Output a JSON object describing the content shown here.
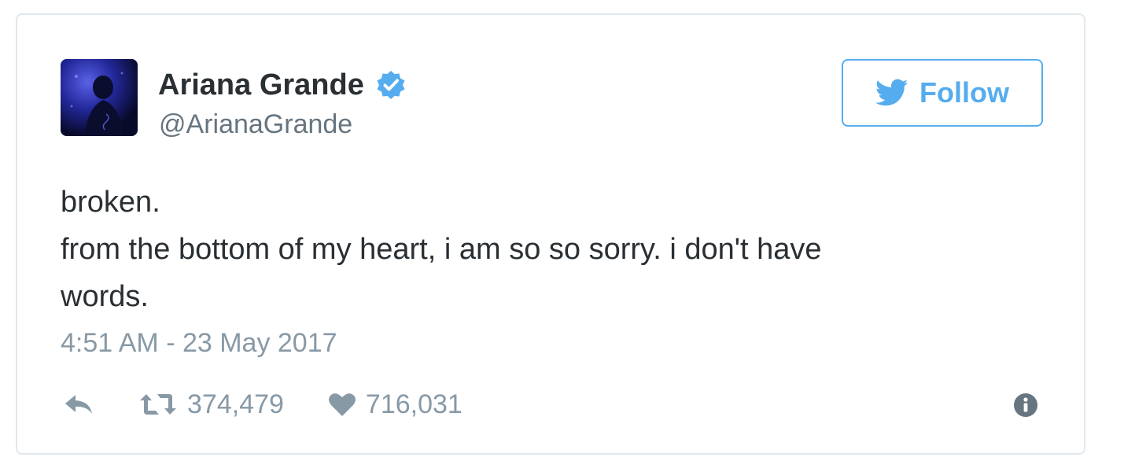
{
  "user": {
    "display_name": "Ariana Grande",
    "handle": "@ArianaGrande",
    "verified": true,
    "avatar_icon": "profile-photo"
  },
  "follow_button": {
    "label": "Follow",
    "icon": "twitter-bird-icon",
    "color": "#55acee"
  },
  "tweet": {
    "lines": [
      "broken.",
      "from the bottom of my heart, i am so so sorry. i don't have",
      "words."
    ],
    "timestamp": "4:51 AM - 23 May 2017"
  },
  "actions": {
    "reply_icon": "reply-icon",
    "retweet_icon": "retweet-icon",
    "retweet_count": "374,479",
    "like_icon": "heart-icon",
    "like_count": "716,031",
    "info_icon": "info-icon"
  },
  "colors": {
    "name": "#292f33",
    "secondary": "#66757f",
    "muted": "#8899a6",
    "accent": "#55acee",
    "border": "#e1e8ed"
  }
}
